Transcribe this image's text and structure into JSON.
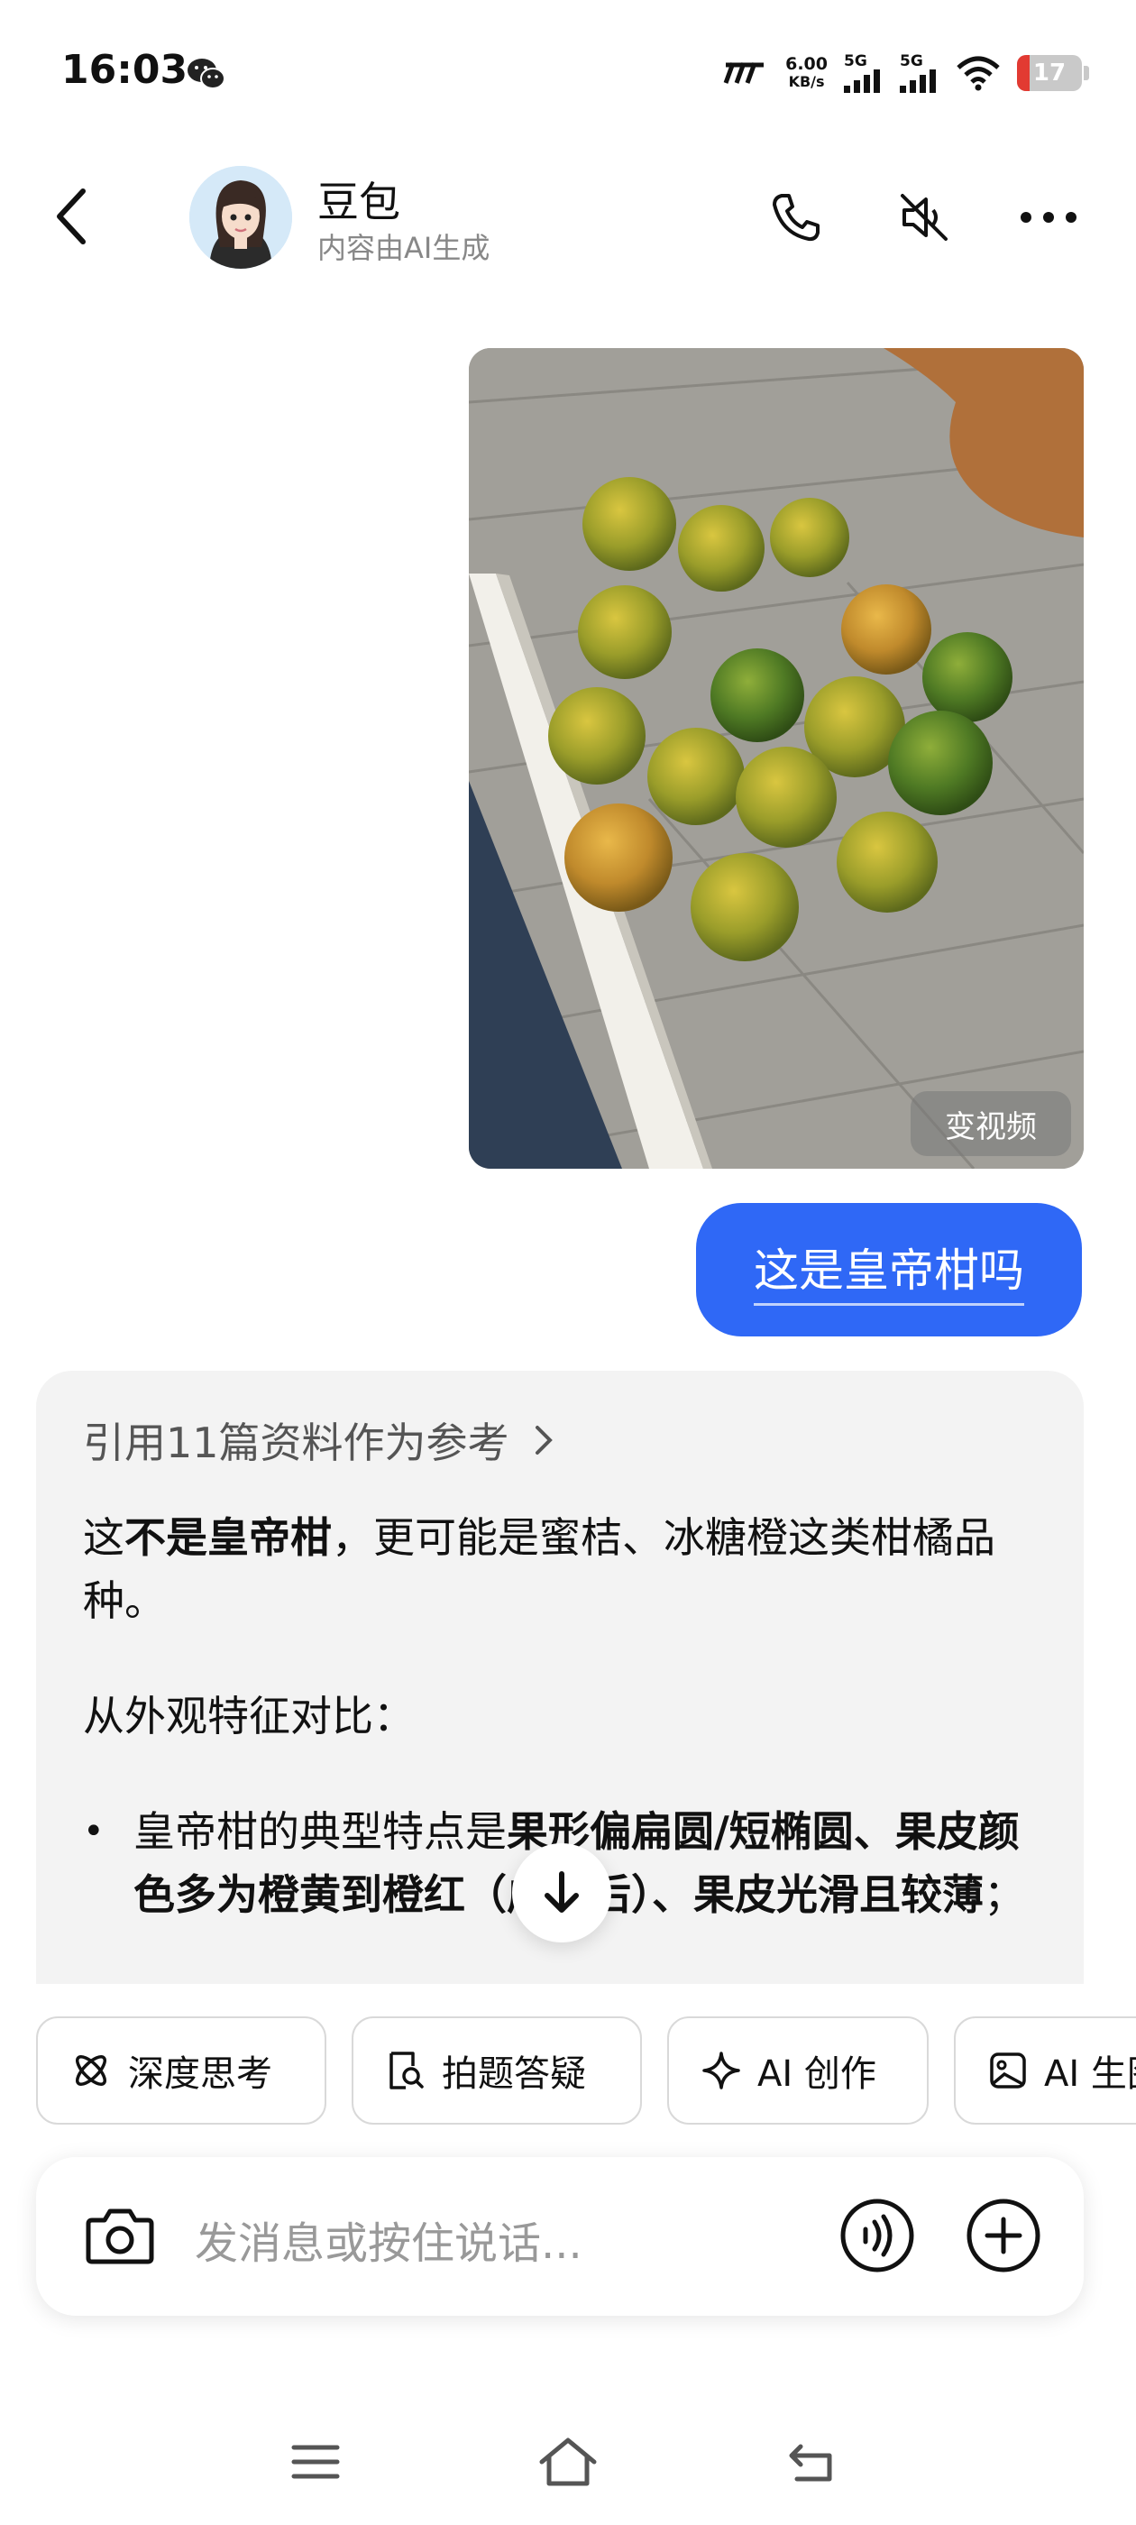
{
  "status_bar": {
    "time": "16:03",
    "net_speed_value": "6.00",
    "net_speed_unit": "KB/s",
    "signal1_label": "5G",
    "signal2_label": "5G",
    "battery": "17",
    "icons": [
      "wechat-icon",
      "speed-brand-icon",
      "signal-icon",
      "wifi-icon",
      "battery-icon"
    ]
  },
  "header": {
    "name": "豆包",
    "subtitle": "内容由AI生成",
    "icons": [
      "back-icon",
      "phone-icon",
      "mute-icon",
      "more-icon"
    ]
  },
  "image_message": {
    "video_tag": "变视频"
  },
  "user_message": {
    "text": "这是皇帝柑吗"
  },
  "ai_reply": {
    "refs": "引用11篇资料作为参考",
    "p1_pre": "这",
    "p1_bold": "不是皇帝柑",
    "p1_post": "，更可能是蜜桔、冰糖橙这类柑橘品种。",
    "p2": "从外观特征对比：",
    "b1_pre": "皇帝柑的典型特点是",
    "b1_bold": "果形偏扁圆/短椭圆、果皮颜色多为橙黄到橙红（成熟后）、果皮光滑且较薄",
    "b1_post": "；"
  },
  "chips": [
    {
      "label": "深度思考",
      "icon": "atom-icon"
    },
    {
      "label": "拍题答疑",
      "icon": "document-search-icon"
    },
    {
      "label": "AI 创作",
      "icon": "sparkle-icon"
    },
    {
      "label": "AI 生图",
      "icon": "image-icon"
    }
  ],
  "input": {
    "placeholder": "发消息或按住说话..."
  },
  "colors": {
    "accent": "#2f68f6",
    "card_bg": "#f3f3f3"
  }
}
